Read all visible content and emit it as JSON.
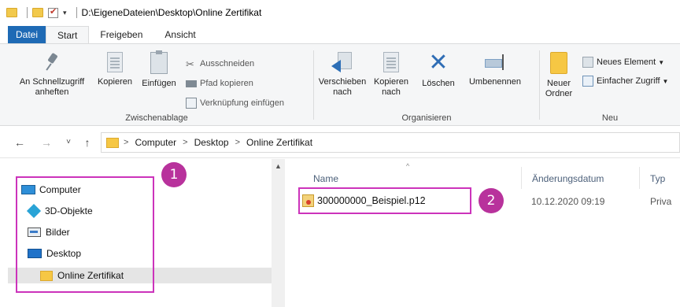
{
  "titlebar": {
    "path": "D:\\EigeneDateien\\Desktop\\Online Zertifikat",
    "dropdown_glyph": "▾"
  },
  "tabs": [
    {
      "label": "Datei"
    },
    {
      "label": "Start"
    },
    {
      "label": "Freigeben"
    },
    {
      "label": "Ansicht"
    }
  ],
  "ribbon": {
    "zwischenablage": {
      "label": "Zwischenablage",
      "pin_label_1": "An Schnellzugriff",
      "pin_label_2": "anheften",
      "copy_label": "Kopieren",
      "paste_label": "Einfügen",
      "cut_label": "Ausschneiden",
      "copy_path_label": "Pfad kopieren",
      "paste_shortcut_label": "Verknüpfung einfügen"
    },
    "organisieren": {
      "label": "Organisieren",
      "move_label_1": "Verschieben",
      "move_label_2": "nach",
      "copyto_label_1": "Kopieren",
      "copyto_label_2": "nach",
      "delete_label": "Löschen",
      "rename_label": "Umbenennen"
    },
    "neu": {
      "label": "Neu",
      "new_folder_1": "Neuer",
      "new_folder_2": "Ordner",
      "new_item_label": "Neues Element",
      "easy_access_label": "Einfacher Zugriff"
    }
  },
  "address": {
    "crumbs": [
      "Computer",
      "Desktop",
      "Online Zertifikat"
    ]
  },
  "nav": {
    "back": "←",
    "forward": "→",
    "recent": "˅",
    "up": "↑"
  },
  "tree": [
    {
      "label": "Computer",
      "icon": "computer-icon"
    },
    {
      "label": "3D-Objekte",
      "icon": "3d-objects-icon"
    },
    {
      "label": "Bilder",
      "icon": "pictures-icon"
    },
    {
      "label": "Desktop",
      "icon": "desktop-icon"
    },
    {
      "label": "Online Zertifikat",
      "icon": "folder-icon",
      "selected": true
    }
  ],
  "columns": {
    "name": "Name",
    "date": "Änderungsdatum",
    "type": "Typ"
  },
  "files": [
    {
      "name": "300000000_Beispiel.p12",
      "date": "10.12.2020 09:19",
      "type": "Priva"
    }
  ],
  "callouts": [
    "1",
    "2"
  ],
  "colors": {
    "accent": "#1e6ab5",
    "callout": "#b8329c",
    "callout_border": "#cc33bb"
  }
}
